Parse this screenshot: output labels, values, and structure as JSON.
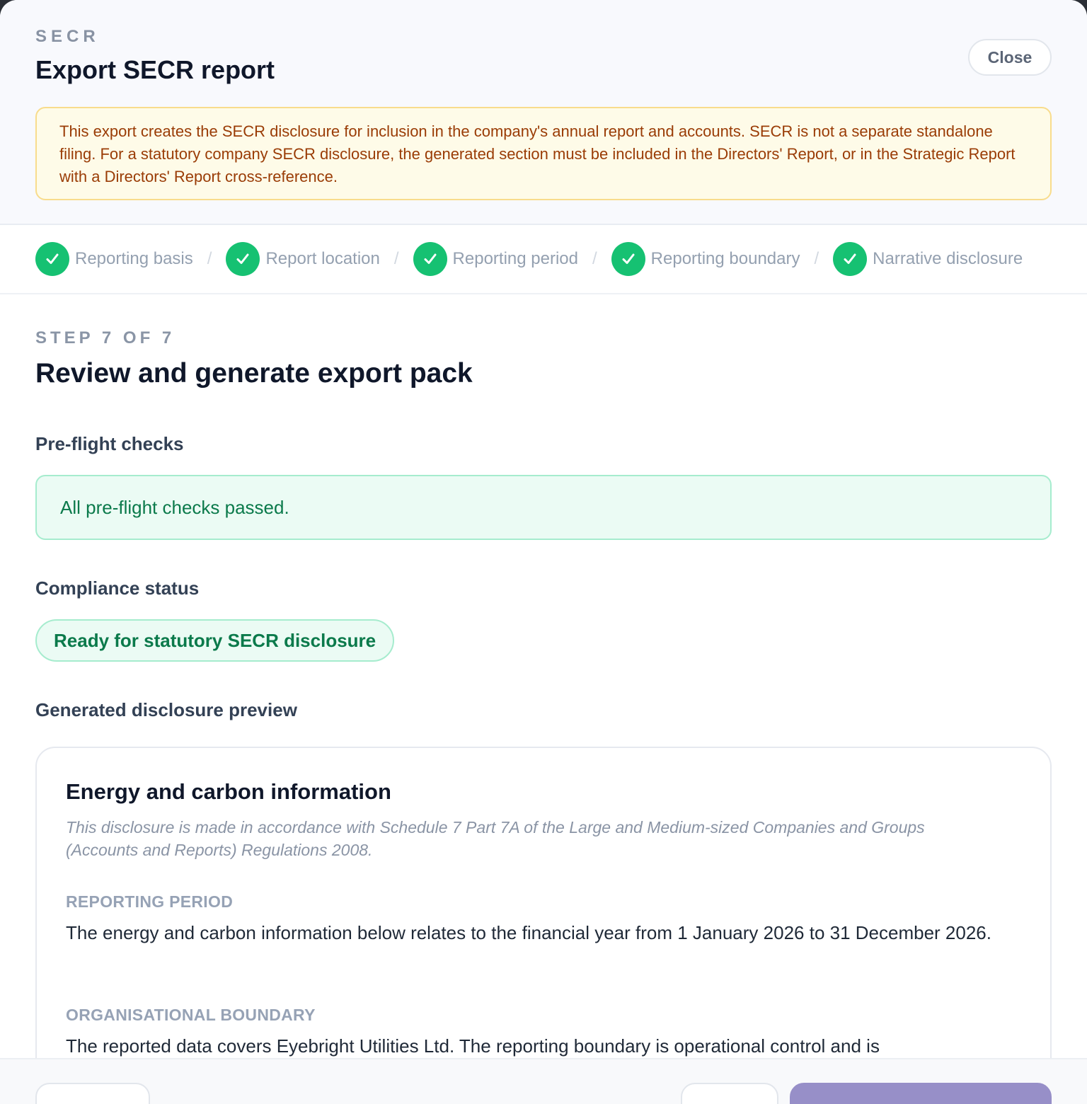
{
  "header": {
    "eyebrow": "SECR",
    "title": "Export SECR report",
    "close_label": "Close",
    "notice": "This export creates the SECR disclosure for inclusion in the company's annual report and accounts. SECR is not a separate standalone filing. For a statutory company SECR disclosure, the generated section must be included in the Directors' Report, or in the Strategic Report with a Directors' Report cross-reference."
  },
  "steps": [
    {
      "label": "Reporting basis",
      "status": "complete"
    },
    {
      "label": "Report location",
      "status": "complete"
    },
    {
      "label": "Reporting period",
      "status": "complete"
    },
    {
      "label": "Reporting boundary",
      "status": "complete"
    },
    {
      "label": "Narrative disclosure",
      "status": "complete"
    }
  ],
  "step_separator": "/",
  "main": {
    "step_count": "STEP 7 OF 7",
    "step_title": "Review and generate export pack",
    "preflight_heading": "Pre-flight checks",
    "preflight_message": "All pre-flight checks passed.",
    "compliance_heading": "Compliance status",
    "compliance_status": "Ready for statutory SECR disclosure",
    "preview_heading": "Generated disclosure preview"
  },
  "preview": {
    "title": "Energy and carbon information",
    "note": "This disclosure is made in accordance with Schedule 7 Part 7A of the Large and Medium-sized Companies and Groups (Accounts and Reports) Regulations 2008.",
    "reporting_period_label": "REPORTING PERIOD",
    "reporting_period_text": "The energy and carbon information below relates to the financial year from 1 January 2026 to 31 December 2026.",
    "boundary_label": "ORGANISATIONAL BOUNDARY",
    "boundary_text": "The reported data covers Eyebright Utilities Ltd. The reporting boundary is operational control and is"
  },
  "colors": {
    "accent_green": "#16c172",
    "warning_text": "#9a3c06",
    "primary_button": "#978fc8"
  }
}
